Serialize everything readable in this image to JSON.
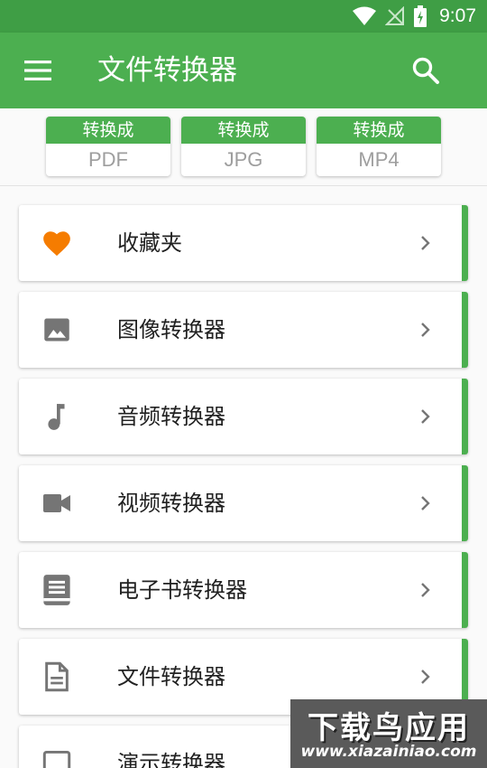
{
  "status_bar": {
    "time": "9:07"
  },
  "app_bar": {
    "title": "文件转换器",
    "menu_icon": "menu-icon",
    "search_icon": "search-icon"
  },
  "quick_convert": [
    {
      "heading": "转换成",
      "format": "PDF"
    },
    {
      "heading": "转换成",
      "format": "JPG"
    },
    {
      "heading": "转换成",
      "format": "MP4"
    }
  ],
  "menu_items": [
    {
      "label": "收藏夹",
      "icon": "heart-icon"
    },
    {
      "label": "图像转换器",
      "icon": "image-icon"
    },
    {
      "label": "音频转换器",
      "icon": "music-note-icon"
    },
    {
      "label": "视频转换器",
      "icon": "video-camera-icon"
    },
    {
      "label": "电子书转换器",
      "icon": "book-icon"
    },
    {
      "label": "文件转换器",
      "icon": "document-icon"
    },
    {
      "label": "演示转换器",
      "icon": "presentation-icon"
    }
  ],
  "watermark": {
    "title": "下载鸟应用",
    "url": "www.xiazainiao.com"
  },
  "colors": {
    "primary": "#4caf50",
    "status_bar": "#3f9e45",
    "favorite": "#f57c00",
    "icon_gray": "#757575"
  }
}
